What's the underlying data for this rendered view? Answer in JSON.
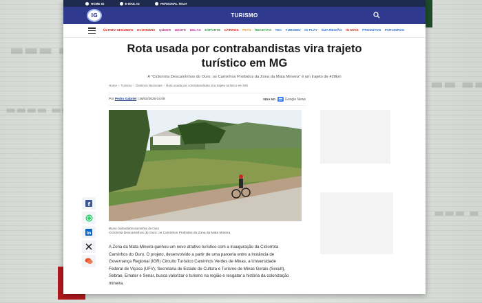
{
  "top_bar": {
    "items": [
      {
        "icon": "homepage-icon",
        "label": "HOME IG"
      },
      {
        "icon": "mail-icon",
        "label": "E-MAIL IG"
      },
      {
        "icon": "computer-icon",
        "label": "PERSONAL TECH"
      }
    ]
  },
  "header": {
    "logo_text": "iG",
    "section_title": "TURISMO",
    "search_icon": "search-icon"
  },
  "nav": {
    "menu_icon": "hamburger-icon",
    "items": [
      {
        "label": "ÚLTIMO SEGUNDO",
        "color": "#d4241a"
      },
      {
        "label": "ECONOMIA",
        "color": "#d4241a"
      },
      {
        "label": "QUEER",
        "color": "#d02a8c"
      },
      {
        "label": "GENTE",
        "color": "#d02a8c"
      },
      {
        "label": "DELAS",
        "color": "#c43aa8"
      },
      {
        "label": "ESPORTE",
        "color": "#2f9e44"
      },
      {
        "label": "CARROS",
        "color": "#d4241a"
      },
      {
        "label": "PETS",
        "color": "#e89a2c"
      },
      {
        "label": "RECEITAS",
        "color": "#2f9e44"
      },
      {
        "label": "TEC",
        "color": "#2a6fd1"
      },
      {
        "label": "TURISMO",
        "color": "#2a6fd1"
      },
      {
        "label": "IG PLAY",
        "color": "#2a6fd1"
      },
      {
        "label": "SUA REGIÃO",
        "color": "#2a6fd1"
      },
      {
        "label": "IG MAIS",
        "color": "#d4241a"
      },
      {
        "label": "PRODUTOS",
        "color": "#2a6fd1"
      },
      {
        "label": "PARCEIROS",
        "color": "#2a6fd1"
      }
    ]
  },
  "article": {
    "headline": "Rota usada por contrabandistas vira trajeto turístico em MG",
    "subtitle": "A \"Ciclorrota Descaminhos do Ouro: os Caminhos Proibidos da Zona da Mata Mineira\" é um trajeto de 420km",
    "breadcrumb": [
      "Home",
      "›",
      "Turismo",
      "›",
      "Destinos Nacionais",
      "›",
      "Rota usada por contrabandistas vira trajeto turístico em MG"
    ],
    "byline_prefix": "Por",
    "author": "Pedro Gabriel",
    "date": "| 26/02/2025 04:08",
    "follow_label": "SIGA NO",
    "google_news_label": "Google News",
    "photo_credit": "Bruno Gallardo/Descaminhos do Ouro",
    "photo_caption": "Ciclorrota Descaminhos do Ouro: os Caminhos Proibidos da Zona da Mata Mineira",
    "body": "A Zona da Mata Mineira ganhou um novo atrativo turístico com a inauguração da Ciclorrota Caminhos do Ouro. O projeto, desenvolvido a partir de uma parceria entre a Instância de Governança Regional (IGR) Circuito Turístico Caminhos Verdes de Minas, a Universidade Federal de Viçosa (UFV), Secretaria de Estado de Cultura e Turismo de Minas Gerais (Secult), Sebrae, Emater e Senar, busca valorizar o turismo na região e resgatar a história da colonização mineira."
  },
  "share": [
    "facebook-icon",
    "whatsapp-icon",
    "linkedin-icon",
    "x-icon",
    "comments-icon"
  ],
  "colors": {
    "top_bar": "#1f2a4f",
    "section_bar": "#2f3a8f",
    "facebook": "#3b5998",
    "whatsapp": "#25d366",
    "linkedin": "#0a66c2",
    "comments": "#e8502e"
  }
}
